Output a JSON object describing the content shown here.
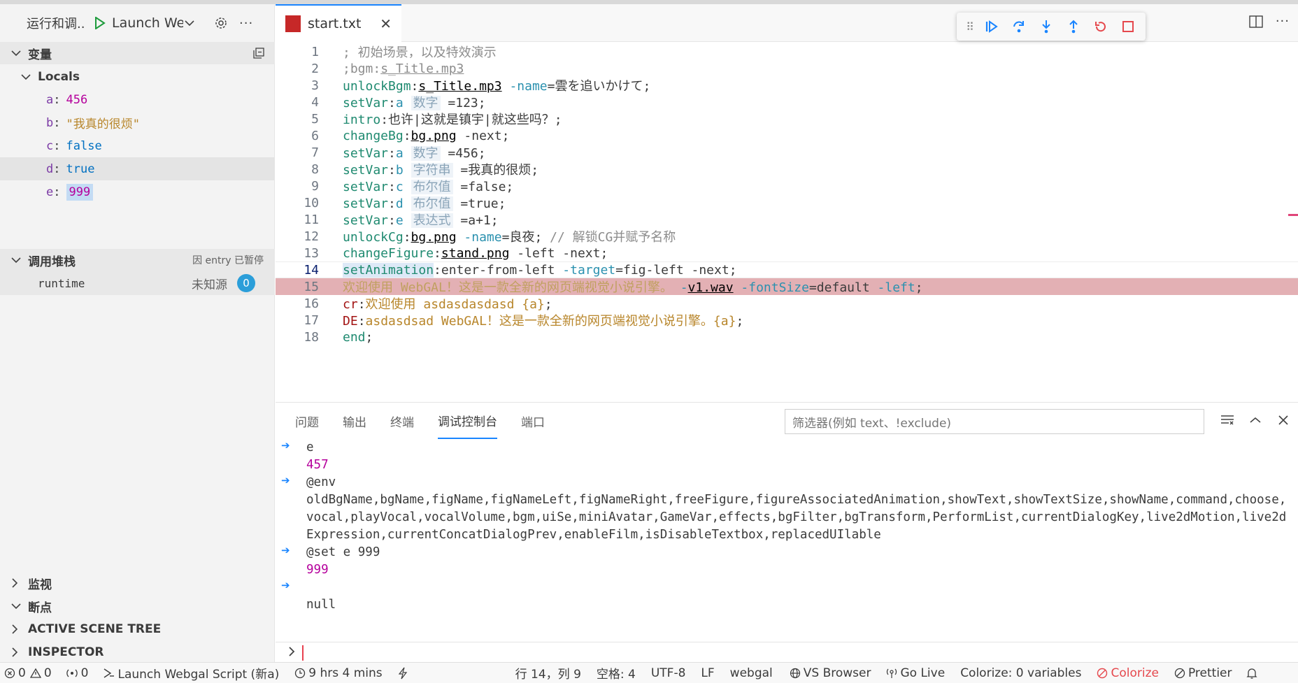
{
  "sidebar": {
    "title": "运行和调...",
    "launch_config": "Launch We",
    "variables_title": "变量",
    "locals_label": "Locals",
    "variables": [
      {
        "name": "a",
        "value": "456",
        "kind": "num"
      },
      {
        "name": "b",
        "value": "\"我真的很烦\"",
        "kind": "str"
      },
      {
        "name": "c",
        "value": "false",
        "kind": "bool"
      },
      {
        "name": "d",
        "value": "true",
        "kind": "bool"
      },
      {
        "name": "e",
        "value": "999",
        "kind": "num"
      }
    ],
    "callstack_title": "调用堆栈",
    "callstack_status": "因 entry 已暂停",
    "callstack_frame": "runtime",
    "callstack_source": "未知源",
    "callstack_badge": "0",
    "watch_title": "监视",
    "breakpoints_title": "断点",
    "scene_tree_title": "ACTIVE SCENE TREE",
    "inspector_title": "INSPECTOR"
  },
  "editor": {
    "tab_label": "start.txt",
    "tab_icon_text": "SCRIPT WEB GAL",
    "current_line": 14,
    "exec_line": 15,
    "line_numbers": [
      "1",
      "2",
      "3",
      "4",
      "5",
      "6",
      "7",
      "8",
      "9",
      "10",
      "11",
      "12",
      "13",
      "14",
      "15",
      "16",
      "17",
      "18"
    ]
  },
  "panel": {
    "tabs": [
      "问题",
      "输出",
      "终端",
      "调试控制台",
      "端口"
    ],
    "active_tab": "调试控制台",
    "filter_placeholder": "筛选器(例如 text、!exclude)",
    "console": {
      "l1": "e",
      "l2": "457",
      "l3": "@env",
      "l4": "oldBgName,bgName,figName,figNameLeft,figNameRight,freeFigure,figureAssociatedAnimation,showText,showTextSize,showName,command,choose,vocal,playVocal,vocalVolume,bgm,uiSe,miniAvatar,GameVar,effects,bgFilter,bgTransform,PerformList,currentDialogKey,live2dMotion,live2dExpression,currentConcatDialogPrev,enableFilm,isDisableTextbox,replacedUIlable",
      "l5": "@set e 999",
      "l6": "999",
      "l7": "null"
    }
  },
  "statusbar": {
    "errors": "0",
    "warnings": "0",
    "ports": "0",
    "launch": "Launch Webgal Script (新a)",
    "time": "9 hrs 4 mins",
    "position": "行 14，列 9",
    "spaces": "空格: 4",
    "encoding": "UTF-8",
    "eol": "LF",
    "language": "webgal",
    "vs_browser": "VS Browser",
    "go_live": "Go Live",
    "colorize_vars": "Colorize: 0 variables",
    "colorize": "Colorize",
    "prettier": "Prettier"
  },
  "colors": {
    "accent": "#1a85ff",
    "exec_line": "#e3b0b4",
    "keyword": "#1f8a70",
    "string": "#b8862b",
    "number": "#b5009c",
    "error": "#e5484d"
  }
}
